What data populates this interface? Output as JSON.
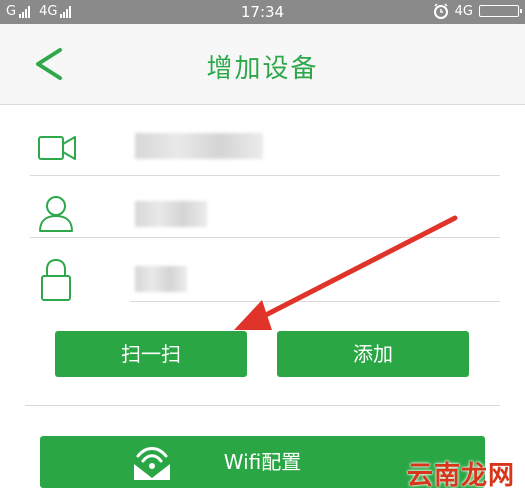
{
  "status_bar": {
    "carrier_left": "G",
    "network_label": "4G",
    "time": "17:34",
    "network_right": "4G"
  },
  "header": {
    "title": "增加设备"
  },
  "form": {
    "device_field": {
      "value": ""
    },
    "user_field": {
      "value": ""
    },
    "password_field": {
      "value": ""
    }
  },
  "buttons": {
    "scan_label": "扫一扫",
    "add_label": "添加",
    "wifi_label": "Wifi配置"
  },
  "watermark": "云南龙网",
  "colors": {
    "brand_green": "#2aa744",
    "title_green": "#2ea84a",
    "arrow_red": "#e0342a"
  },
  "icons": {
    "back": "chevron-left-icon",
    "device": "camera-icon",
    "user": "user-icon",
    "password": "lock-icon",
    "wifi": "wifi-envelope-icon"
  }
}
